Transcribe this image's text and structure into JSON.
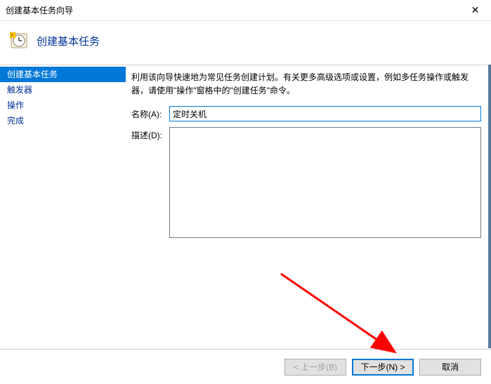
{
  "titlebar": {
    "title": "创建基本任务向导"
  },
  "header": {
    "title": "创建基本任务"
  },
  "sidebar": {
    "items": [
      {
        "label": "创建基本任务",
        "active": true
      },
      {
        "label": "触发器",
        "active": false
      },
      {
        "label": "操作",
        "active": false
      },
      {
        "label": "完成",
        "active": false
      }
    ]
  },
  "content": {
    "instruction": "利用该向导快速地为常见任务创建计划。有关更多高级选项或设置，例如多任务操作或触发器，请使用\"操作\"窗格中的\"创建任务\"命令。",
    "name_label": "名称(A):",
    "name_value": "定时关机",
    "desc_label": "描述(D):",
    "desc_value": ""
  },
  "footer": {
    "back": "< 上一步(B)",
    "next": "下一步(N) >",
    "cancel": "取消"
  }
}
